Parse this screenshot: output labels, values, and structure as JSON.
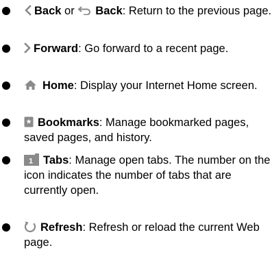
{
  "items": [
    {
      "name": "Back",
      "connector": " or ",
      "name2": "Back",
      "desc": ": Return to the previous page."
    },
    {
      "name": "Forward",
      "desc": ": Go forward to a recent page."
    },
    {
      "name": "Home",
      "desc": ": Display your Internet Home screen."
    },
    {
      "name": "Bookmarks",
      "desc": ": Manage bookmarked pages, saved pages, and history."
    },
    {
      "name": "Tabs",
      "desc": ": Manage open tabs. The number on the icon indicates the number of tabs that are currently open."
    },
    {
      "name": "Refresh",
      "desc": ": Refresh or reload the current Web page."
    }
  ],
  "icons": {
    "back": "chevron-left-icon",
    "back_alt": "return-arrow-icon",
    "forward": "chevron-right-icon",
    "home": "home-icon",
    "bookmarks": "bookmark-icon",
    "tabs": "tabs-icon",
    "refresh": "refresh-icon"
  },
  "colors": {
    "icon_gray": "#8a8a8a",
    "text": "#000000"
  }
}
